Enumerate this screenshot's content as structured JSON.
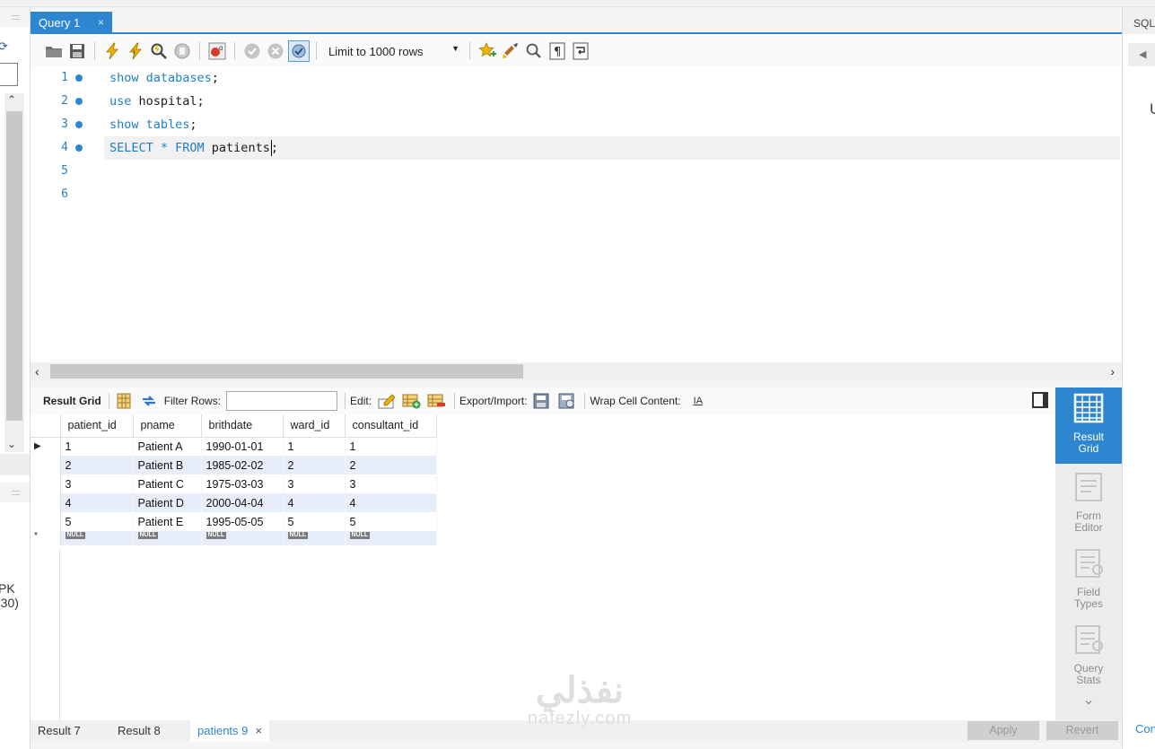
{
  "editor_tab": {
    "title": "Query 1",
    "close": "×"
  },
  "toolbar": {
    "limit_label": "Limit to 1000 rows"
  },
  "editor": {
    "lines": [
      {
        "num": "1",
        "kw": "show databases",
        "rest": ";"
      },
      {
        "num": "2",
        "kw": "use",
        "rest": " hospital;"
      },
      {
        "num": "3",
        "kw": "show tables",
        "rest": ";"
      },
      {
        "num": "4",
        "kw": "SELECT * FROM",
        "rest_a": " patients",
        "rest_b": ";"
      },
      {
        "num": "5"
      },
      {
        "num": "6"
      }
    ]
  },
  "results_toolbar": {
    "result_grid": "Result Grid",
    "filter_rows": "Filter Rows:",
    "edit": "Edit:",
    "export_import": "Export/Import:",
    "wrap_cell": "Wrap Cell Content:",
    "wrap_icon": "IA"
  },
  "grid": {
    "columns": [
      "patient_id",
      "pname",
      "brithdate",
      "ward_id",
      "consultant_id"
    ],
    "rows": [
      [
        "1",
        "Patient A",
        "1990-01-01",
        "1",
        "1"
      ],
      [
        "2",
        "Patient B",
        "1985-02-02",
        "2",
        "2"
      ],
      [
        "3",
        "Patient C",
        "1975-03-03",
        "3",
        "3"
      ],
      [
        "4",
        "Patient D",
        "2000-04-04",
        "4",
        "4"
      ],
      [
        "5",
        "Patient E",
        "1995-05-05",
        "5",
        "5"
      ]
    ],
    "null_label": "NULL",
    "new_row_marker": "*",
    "current_row_marker": "▶"
  },
  "side_panel": {
    "result_grid": "Result Grid",
    "form_editor": "Form Editor",
    "field_types": "Field Types",
    "query_stats": "Query Stats"
  },
  "bottom_tabs": {
    "tabs": [
      "Result 7",
      "Result 8",
      "patients 9"
    ],
    "close": "×",
    "apply": "Apply",
    "revert": "Revert"
  },
  "left_panel": {
    "dots": "::::::",
    "text1": "PK",
    "text2": "(30)"
  },
  "right_panel": {
    "header": "SQL",
    "arrow": "◀",
    "letter": "U",
    "link": "Con"
  },
  "watermark": {
    "arabic": "نفذلي",
    "latin": "nafezly.com"
  },
  "colors": {
    "accent": "#2e86d0",
    "keyword": "#1f7fc4",
    "row_alt": "#e8eef9"
  }
}
